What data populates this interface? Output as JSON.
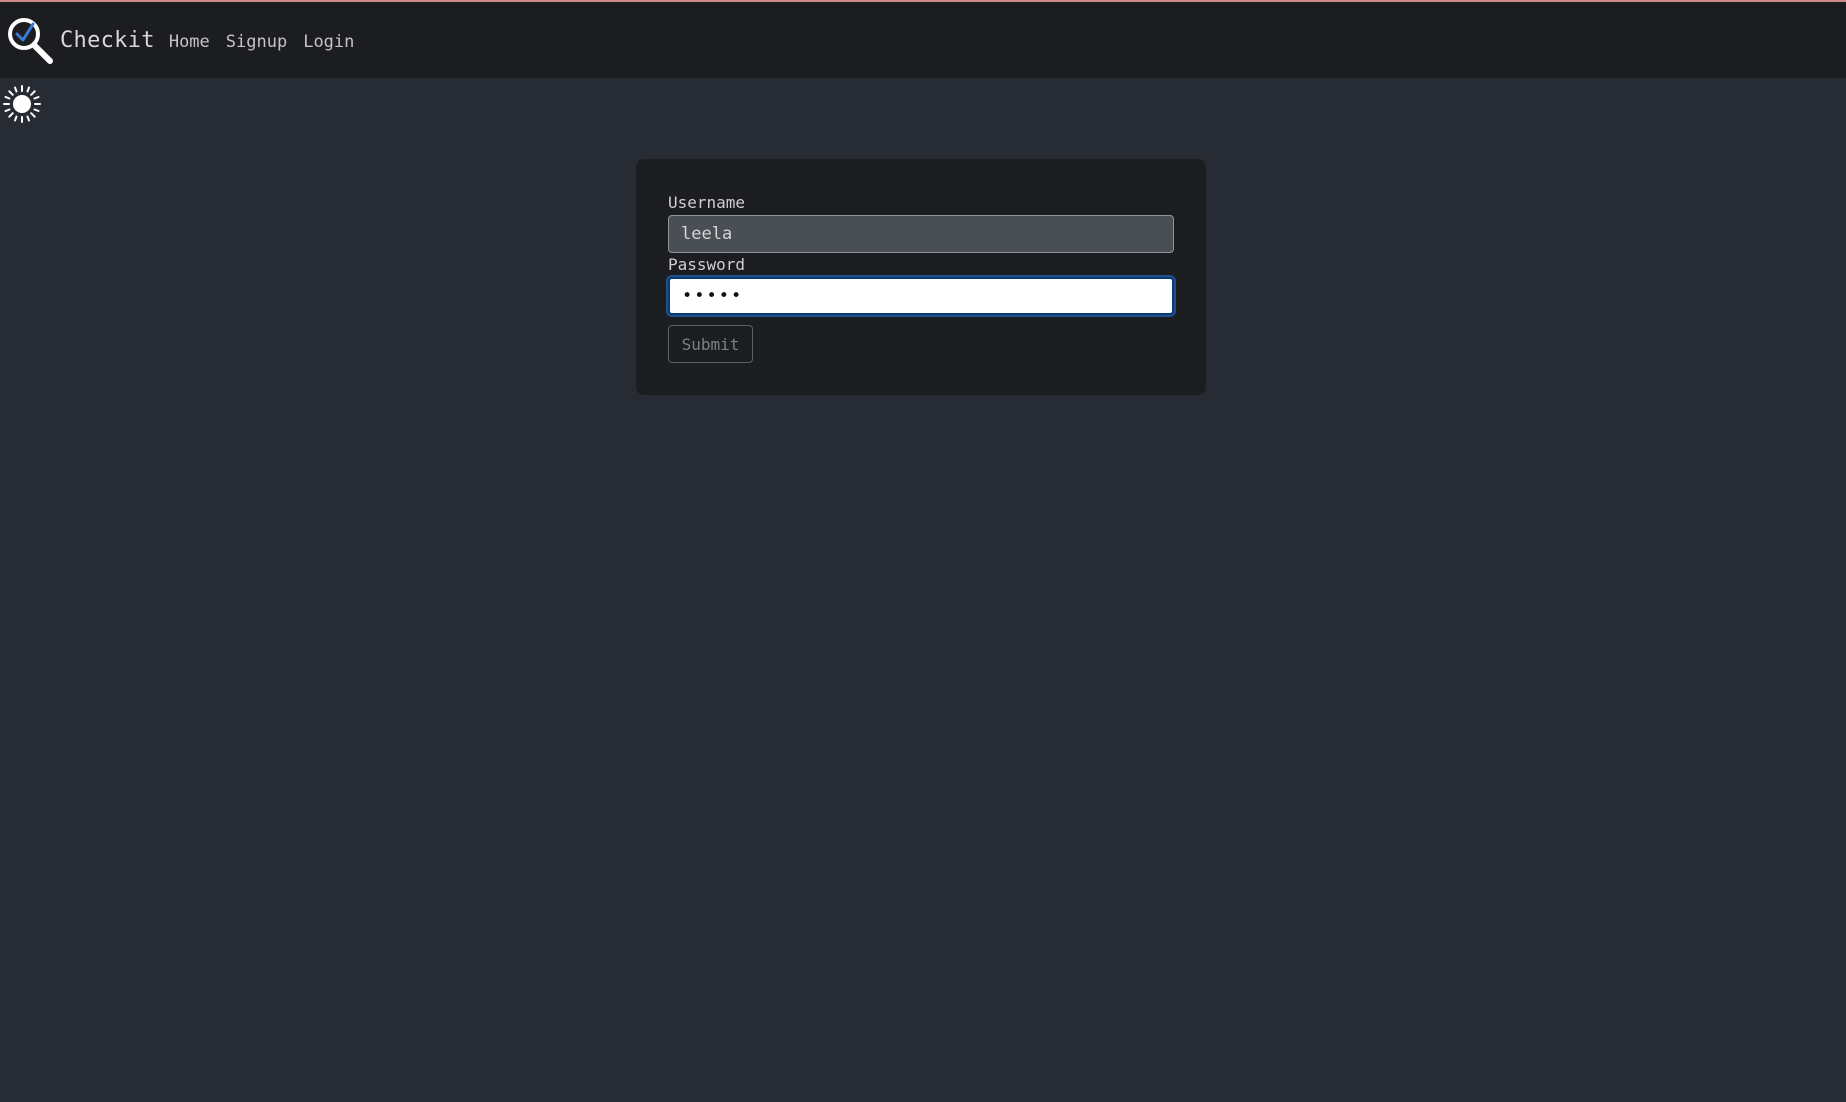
{
  "navbar": {
    "brand_name": "Checkit",
    "links": [
      {
        "label": "Home"
      },
      {
        "label": "Signup"
      },
      {
        "label": "Login"
      }
    ]
  },
  "theme_toggle": {
    "icon": "sun-icon"
  },
  "login_form": {
    "username_label": "Username",
    "username_value": "leela",
    "password_label": "Password",
    "password_value": "•••••",
    "submit_label": "Submit"
  },
  "colors": {
    "background": "#272b34",
    "navbar": "#1b1d20",
    "card": "#1b1d20",
    "focus_border": "#0b3b73",
    "logo_check": "#3a7bd5"
  }
}
